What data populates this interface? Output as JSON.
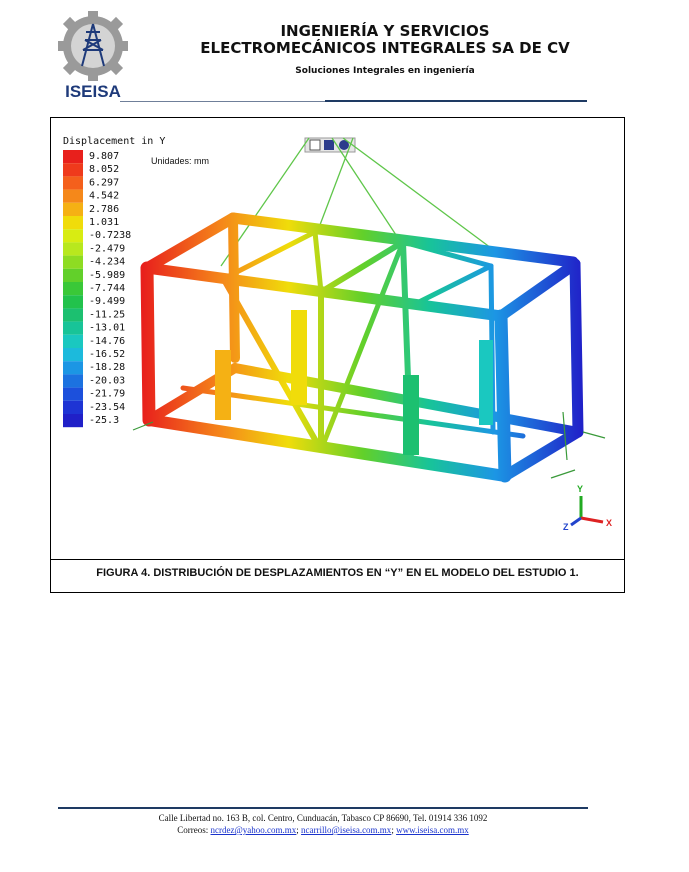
{
  "header": {
    "logo_text": "ISEISA",
    "company_line1": "INGENIERÍA Y SERVICIOS",
    "company_line2": "ELECTROMECÁNICOS INTEGRALES SA DE CV",
    "tagline": "Soluciones Integrales en ingeniería"
  },
  "figure": {
    "legend_title": "Displacement in Y",
    "units": "Unidades: mm",
    "legend": {
      "values": [
        "9.807",
        "8.052",
        "6.297",
        "4.542",
        "2.786",
        "1.031",
        "-0.7238",
        "-2.479",
        "-4.234",
        "-5.989",
        "-7.744",
        "-9.499",
        "-11.25",
        "-13.01",
        "-14.76",
        "-16.52",
        "-18.28",
        "-20.03",
        "-21.79",
        "-23.54",
        "-25.3"
      ],
      "colors": [
        "#e8201c",
        "#ef3a1c",
        "#f4601c",
        "#f5881a",
        "#f5b114",
        "#f0dc0a",
        "#d8ec12",
        "#b8e81e",
        "#8edc22",
        "#62d02a",
        "#3ac838",
        "#22c24c",
        "#1cc070",
        "#18c498",
        "#1ac8c0",
        "#1cbadc",
        "#1c96e4",
        "#1c72e0",
        "#1c50dc",
        "#1e34d4",
        "#2020c8"
      ]
    },
    "axes": {
      "x": "X",
      "y": "Y",
      "z": "Z"
    },
    "caption": "FIGURA 4. DISTRIBUCIÓN DE DESPLAZAMIENTOS EN “Y” EN EL MODELO DEL ESTUDIO 1."
  },
  "footer": {
    "address": "Calle Libertad no. 163 B, col. Centro, Cunduacán, Tabasco CP 86690, Tel. 01914 336 1092",
    "emails_label": "Correos:",
    "email1": "ncrdez@yahoo.com.mx",
    "email2": "ncarrillo@iseisa.com.mx",
    "website": "www.iseisa.com.mx"
  }
}
